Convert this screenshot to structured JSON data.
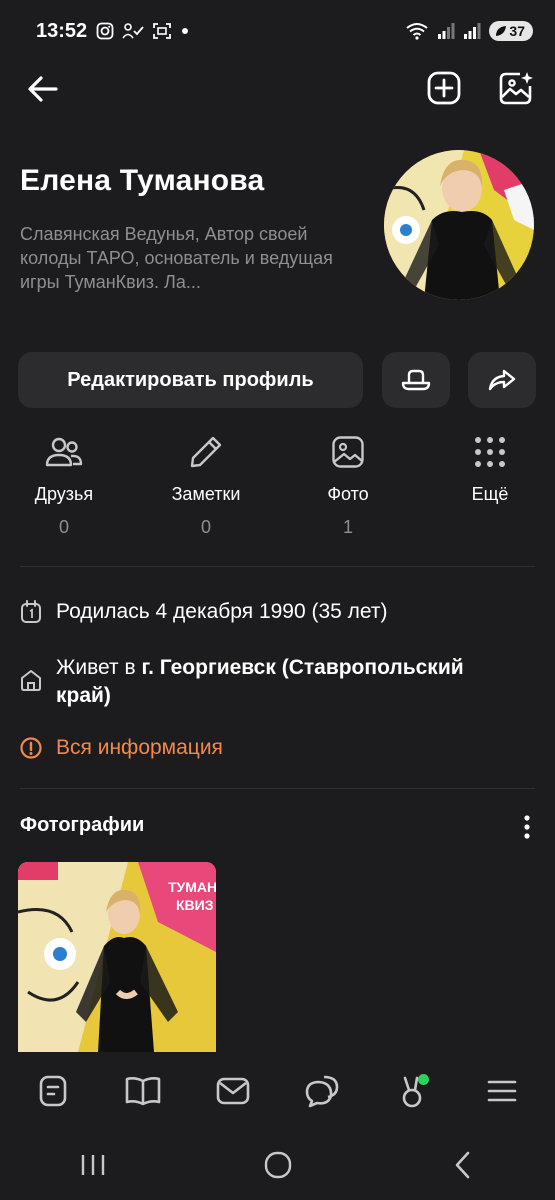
{
  "status_bar": {
    "time": "13:52",
    "battery": "37"
  },
  "header": {
    "back_icon": "arrow-left-icon",
    "add_icon": "plus-square-icon",
    "add_photo_icon": "image-sparkle-icon"
  },
  "profile": {
    "name": "Елена Туманова",
    "bio": "Славянская Ведунья, Автор своей колоды ТАРО,  основатель и ведущая игры ТуманКвиз.  Ла..."
  },
  "actions": {
    "edit_label": "Редактировать профиль",
    "hat_icon": "hat-icon",
    "share_icon": "share-arrow-icon"
  },
  "stats": [
    {
      "label": "Друзья",
      "count": "0",
      "icon": "friends-icon"
    },
    {
      "label": "Заметки",
      "count": "0",
      "icon": "pencil-icon"
    },
    {
      "label": "Фото",
      "count": "1",
      "icon": "photo-icon"
    },
    {
      "label": "Ещё",
      "count": "",
      "icon": "grid-dots-icon"
    }
  ],
  "info": {
    "birthday": "Родилась 4 декабря 1990 (35 лет)",
    "lives_prefix": "Живет в ",
    "lives_city": "г. Георгиевск (Ставропольский край)",
    "all_info": "Вся информация"
  },
  "photos": {
    "title": "Фотографии",
    "thumb_text": "ТУМАН КВИЗ"
  },
  "colors": {
    "accent": "#f2894b",
    "background": "#1c1c1e",
    "button_bg": "#2c2c2e",
    "muted_text": "#8e8e93",
    "online_dot": "#2fd158"
  },
  "tab_bar": [
    "news-icon",
    "book-icon",
    "mail-icon",
    "chat-icon",
    "games-icon",
    "menu-icon"
  ],
  "system_nav": [
    "recents-icon",
    "home-icon",
    "back-icon"
  ]
}
